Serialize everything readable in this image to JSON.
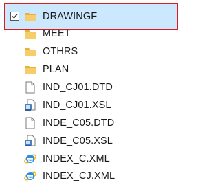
{
  "explorer": {
    "items": [
      {
        "label": "DRAWINGF",
        "icon": "folder-icon",
        "selected": true,
        "checked": true
      },
      {
        "label": "MEET",
        "icon": "folder-icon"
      },
      {
        "label": "OTHRS",
        "icon": "folder-icon"
      },
      {
        "label": "PLAN",
        "icon": "folder-icon"
      },
      {
        "label": "IND_CJ01.DTD",
        "icon": "file-icon"
      },
      {
        "label": "IND_CJ01.XSL",
        "icon": "xsl-file-icon"
      },
      {
        "label": "INDE_C05.DTD",
        "icon": "file-icon"
      },
      {
        "label": "INDE_C05.XSL",
        "icon": "xsl-file-icon"
      },
      {
        "label": "INDEX_C.XML",
        "icon": "ie-file-icon"
      },
      {
        "label": "INDEX_CJ.XML",
        "icon": "ie-file-icon"
      }
    ],
    "colors": {
      "selection_fill": "#cce8ff",
      "selection_outline": "#e0191d",
      "folder": "#f2c560"
    }
  }
}
